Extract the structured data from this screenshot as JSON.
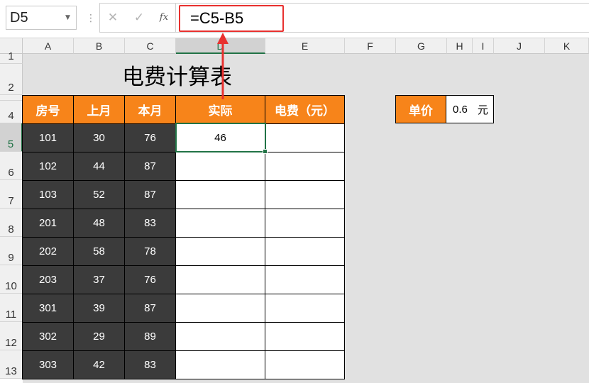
{
  "name_box": {
    "value": "D5"
  },
  "formula_bar": {
    "separator": "⋮",
    "cancel": "✕",
    "enter": "✓",
    "fx": "fx",
    "formula": "=C5-B5"
  },
  "columns": [
    "A",
    "B",
    "C",
    "D",
    "E",
    "F",
    "G",
    "H",
    "I",
    "J",
    "K"
  ],
  "rows": [
    "1",
    "2",
    "",
    "4",
    "5",
    "6",
    "7",
    "8",
    "9",
    "10",
    "11",
    "12",
    "13"
  ],
  "sheet": {
    "title": "电费计算表",
    "headers": [
      "房号",
      "上月",
      "本月",
      "实际",
      "电费（元）"
    ],
    "data": [
      [
        "101",
        "30",
        "76",
        "46",
        ""
      ],
      [
        "102",
        "44",
        "87",
        "",
        ""
      ],
      [
        "103",
        "52",
        "87",
        "",
        ""
      ],
      [
        "201",
        "48",
        "83",
        "",
        ""
      ],
      [
        "202",
        "58",
        "78",
        "",
        ""
      ],
      [
        "203",
        "37",
        "76",
        "",
        ""
      ],
      [
        "301",
        "39",
        "87",
        "",
        ""
      ],
      [
        "302",
        "29",
        "89",
        "",
        ""
      ],
      [
        "303",
        "42",
        "83",
        "",
        ""
      ]
    ],
    "unit_price_label": "单价",
    "unit_price_value": "0.6",
    "unit_price_unit": "元"
  },
  "colors": {
    "header_orange": "#f7841a",
    "dark_cell": "#3b3b3b",
    "selection_green": "#217346",
    "annotation_red": "#e8312f"
  }
}
